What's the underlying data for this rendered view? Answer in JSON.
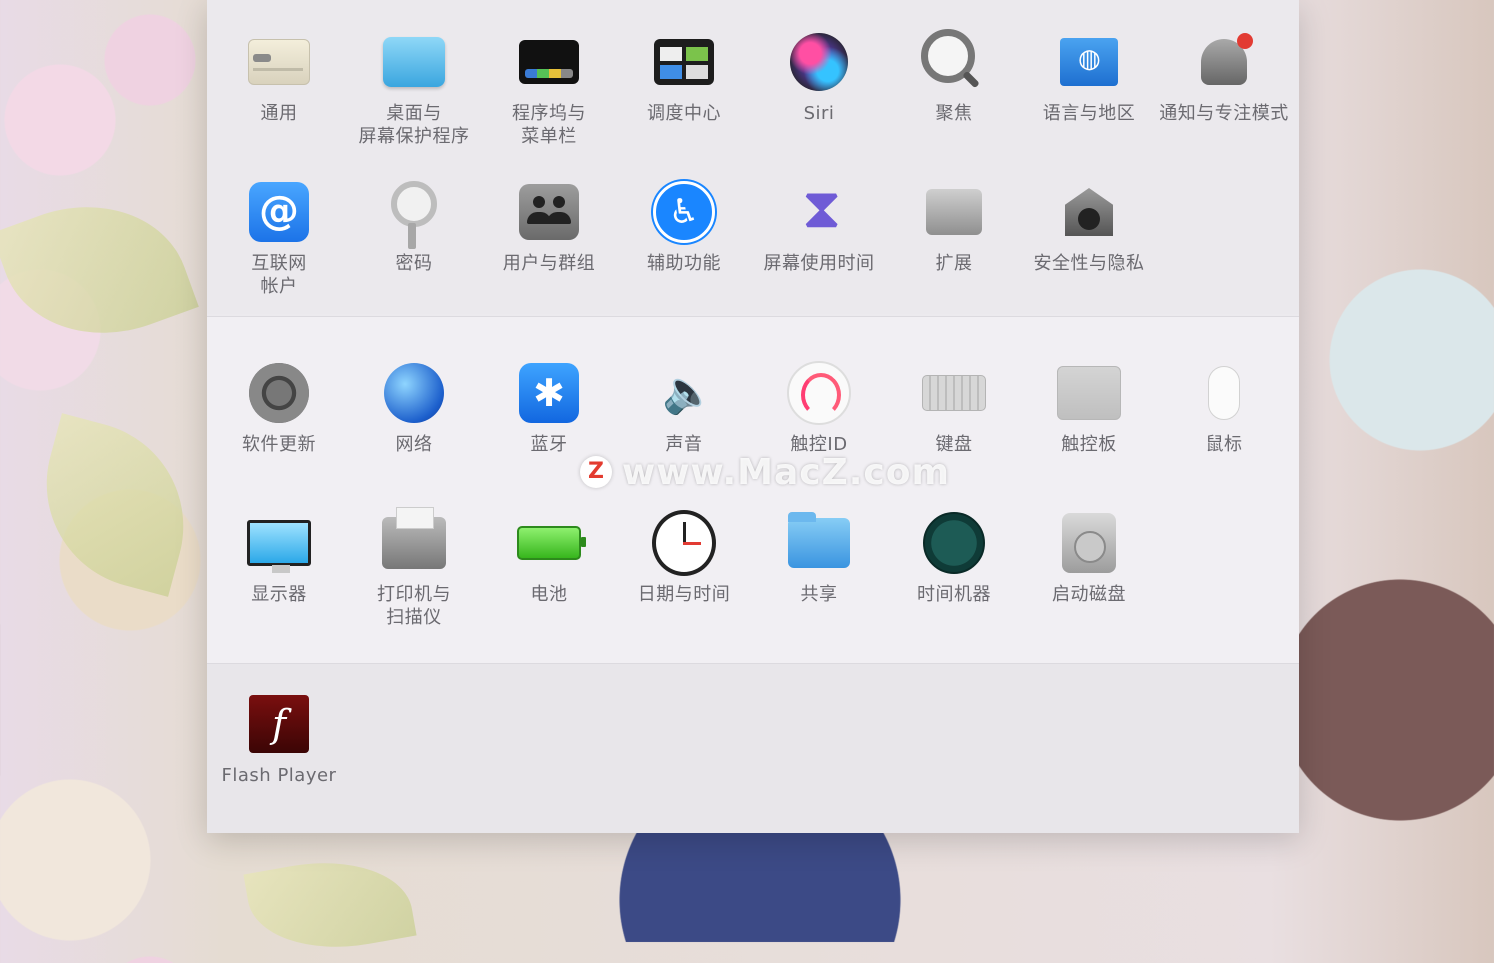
{
  "top_row1": [
    {
      "label": "通用",
      "icon": "general-icon"
    },
    {
      "label": "桌面与\n屏幕保护程序",
      "icon": "desktop-screensaver-icon"
    },
    {
      "label": "程序坞与\n菜单栏",
      "icon": "dock-menubar-icon"
    },
    {
      "label": "调度中心",
      "icon": "mission-control-icon"
    },
    {
      "label": "Siri",
      "icon": "siri-icon"
    },
    {
      "label": "聚焦",
      "icon": "spotlight-icon"
    },
    {
      "label": "语言与地区",
      "icon": "language-region-icon"
    },
    {
      "label": "通知与专注模式",
      "icon": "notifications-focus-icon"
    }
  ],
  "top_row2": [
    {
      "label": "互联网\n帐户",
      "icon": "internet-accounts-icon",
      "glyph": "@"
    },
    {
      "label": "密码",
      "icon": "passwords-icon"
    },
    {
      "label": "用户与群组",
      "icon": "users-groups-icon"
    },
    {
      "label": "辅助功能",
      "icon": "accessibility-icon",
      "glyph": "♿"
    },
    {
      "label": "屏幕使用时间",
      "icon": "screen-time-icon"
    },
    {
      "label": "扩展",
      "icon": "extensions-icon"
    },
    {
      "label": "安全性与隐私",
      "icon": "security-privacy-icon"
    }
  ],
  "mid_row1": [
    {
      "label": "软件更新",
      "icon": "software-update-icon"
    },
    {
      "label": "网络",
      "icon": "network-icon"
    },
    {
      "label": "蓝牙",
      "icon": "bluetooth-icon",
      "glyph": "✱"
    },
    {
      "label": "声音",
      "icon": "sound-icon"
    },
    {
      "label": "触控ID",
      "icon": "touch-id-icon"
    },
    {
      "label": "键盘",
      "icon": "keyboard-icon"
    },
    {
      "label": "触控板",
      "icon": "trackpad-icon"
    },
    {
      "label": "鼠标",
      "icon": "mouse-icon"
    }
  ],
  "mid_row2": [
    {
      "label": "显示器",
      "icon": "displays-icon"
    },
    {
      "label": "打印机与\n扫描仪",
      "icon": "printers-scanners-icon"
    },
    {
      "label": "电池",
      "icon": "battery-icon"
    },
    {
      "label": "日期与时间",
      "icon": "date-time-icon"
    },
    {
      "label": "共享",
      "icon": "sharing-icon"
    },
    {
      "label": "时间机器",
      "icon": "time-machine-icon"
    },
    {
      "label": "启动磁盘",
      "icon": "startup-disk-icon"
    }
  ],
  "bottom_row": [
    {
      "label": "Flash Player",
      "icon": "flash-player-icon",
      "glyph": "f"
    }
  ],
  "watermark": {
    "logo": "Z",
    "text": "www.MacZ.com"
  }
}
